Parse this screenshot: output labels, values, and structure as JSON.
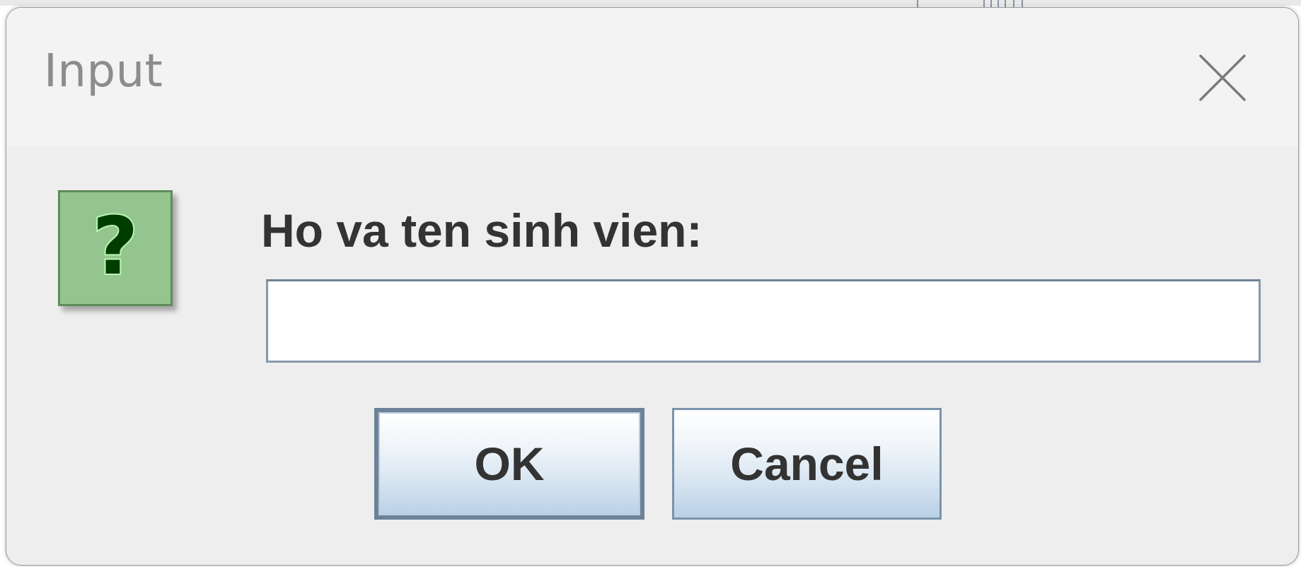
{
  "dialog": {
    "title": "Input",
    "close_icon": "close-icon",
    "message_icon": "question-icon",
    "prompt": "Ho va ten sinh vien:",
    "input_value": "",
    "buttons": {
      "ok_label": "OK",
      "cancel_label": "Cancel"
    }
  },
  "colors": {
    "icon_fill": "#95c58f",
    "icon_glyph": "#003e00",
    "button_border": "#7a93ac",
    "title_text": "#8c8c8c",
    "dialog_background": "#eeeeee"
  },
  "icon_glyphs": {
    "question": "?"
  }
}
